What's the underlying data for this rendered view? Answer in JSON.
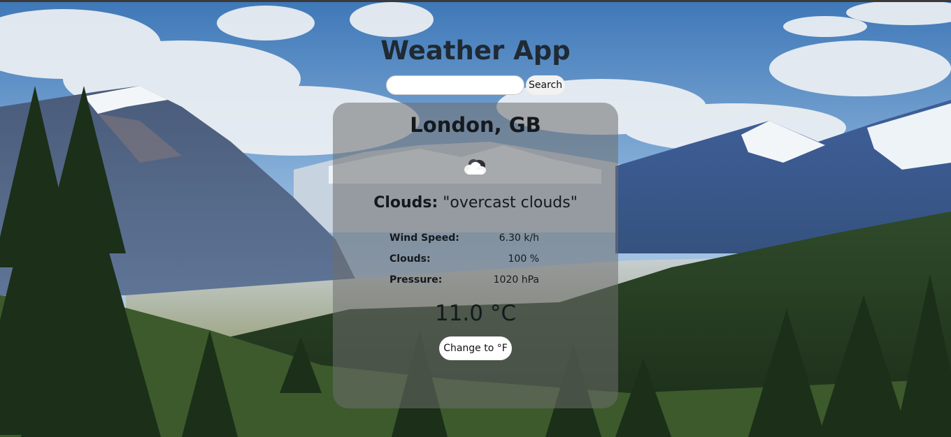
{
  "app": {
    "title": "Weather App"
  },
  "search": {
    "placeholder": "",
    "value": "",
    "button_label": "Search"
  },
  "weather": {
    "city": "London, GB",
    "icon": "cloud-icon",
    "condition_label": "Clouds:",
    "condition_description": "\"overcast clouds\"",
    "stats": [
      {
        "label": "Wind Speed:",
        "value": "6.30 k/h"
      },
      {
        "label": "Clouds:",
        "value": "100 %"
      },
      {
        "label": "Pressure:",
        "value": "1020 hPa"
      }
    ],
    "temperature": "11.0 °C",
    "unit_button_label": "Change to °F"
  },
  "colors": {
    "title": "#1f2a33",
    "card_background": "rgba(110,110,110,0.55)",
    "text": "#15191d",
    "button_background": "#ffffff"
  }
}
